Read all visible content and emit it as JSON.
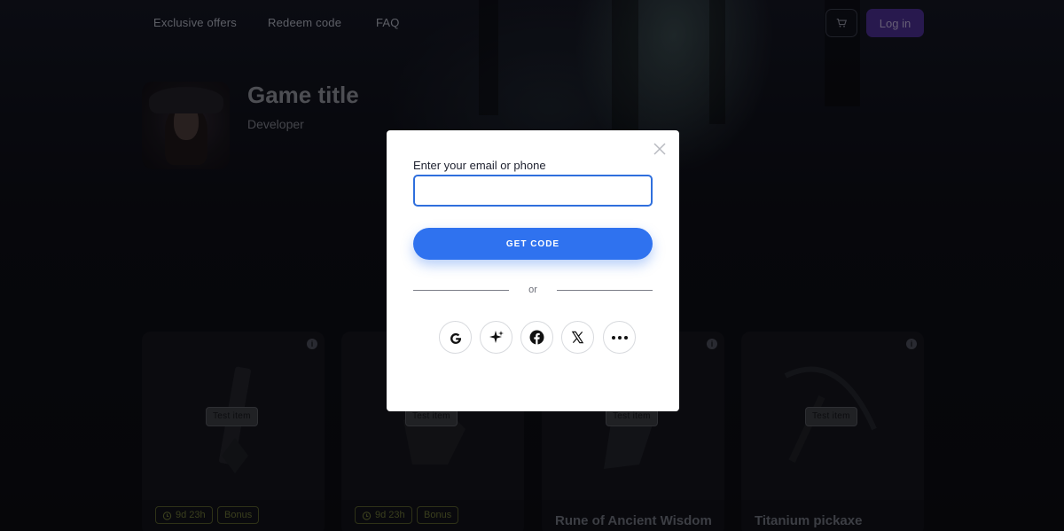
{
  "nav": {
    "links": [
      "Exclusive offers",
      "Redeem code",
      "FAQ"
    ],
    "login_label": "Log in",
    "cart_icon": "cart-icon"
  },
  "game": {
    "title": "Game title",
    "developer": "Developer"
  },
  "cards": [
    {
      "tag": "Test item",
      "name": "",
      "timer": "9d 23h",
      "bonus": "Bonus"
    },
    {
      "tag": "Test item",
      "name": "",
      "timer": "9d 23h",
      "bonus": "Bonus"
    },
    {
      "tag": "Test item",
      "name": "Rune of Ancient Wisdom"
    },
    {
      "tag": "Test item",
      "name": "Titanium pickaxe"
    }
  ],
  "modal": {
    "label": "Enter your email or phone",
    "input_value": "",
    "get_code_label": "GET CODE",
    "or_text": "or",
    "social_icons": [
      "google-icon",
      "sparkle-icon",
      "facebook-icon",
      "x-icon",
      "more-icon"
    ]
  },
  "colors": {
    "primary": "#2f72ef",
    "login": "#4a2e8e",
    "input_border": "#2f6fdd"
  }
}
